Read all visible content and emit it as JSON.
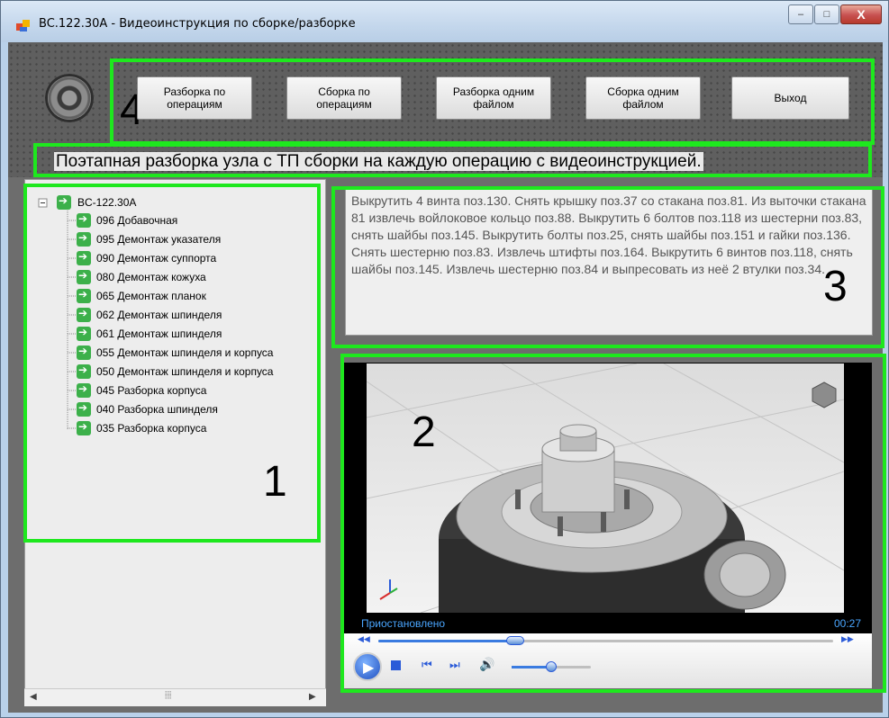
{
  "window": {
    "title": "BC.122.30A - Видеоинструкция по сборке/разборке",
    "buttons": {
      "minimize": "–",
      "maximize": "□",
      "close": "X"
    }
  },
  "toolbar": {
    "buttons": [
      "Разборка по операциям",
      "Сборка по операциям",
      "Разборка одним файлом",
      "Сборка одним файлом",
      "Выход"
    ]
  },
  "caption": "Поэтапная разборка узла с ТП сборки на каждую операцию с видеоинструкцией.",
  "tree": {
    "root": "BC-122.30A",
    "items": [
      "096 Добавочная",
      "095 Демонтаж указателя",
      "090 Демонтаж суппорта",
      "080 Демонтаж кожуха",
      "065 Демонтаж планок",
      "062 Демонтаж шпинделя",
      "061 Демонтаж шпинделя",
      "055 Демонтаж шпинделя и корпуса",
      "050 Демонтаж шпинделя и корпуса",
      "045 Разборка корпуса",
      "040 Разборка шпинделя",
      "035 Разборка корпуса"
    ]
  },
  "instructions": "Выкрутить 4 винта поз.130. Снять крышку поз.37 со стакана поз.81. Из выточки стакана 81 извлечь войлоковое кольцо поз.88. Выкрутить 6 болтов поз.118 из шестерни поз.83, снять шайбы поз.145. Выкрутить болты поз.25, снять шайбы поз.151 и гайки поз.136. Снять шестерню поз.83. Извлечь штифты поз.164. Выкрутить 6 винтов поз.118, снять шайбы поз.145. Извлечь шестерню поз.84 и выпресовать из неё 2 втулки поз.34.",
  "player": {
    "status": "Приостановлено",
    "time": "00:27",
    "seek_fraction": 0.3,
    "volume_fraction": 0.5
  },
  "annotations": {
    "n1": "1",
    "n2": "2",
    "n3": "3",
    "n4": "4"
  },
  "colors": {
    "highlight": "#1ee81e"
  }
}
